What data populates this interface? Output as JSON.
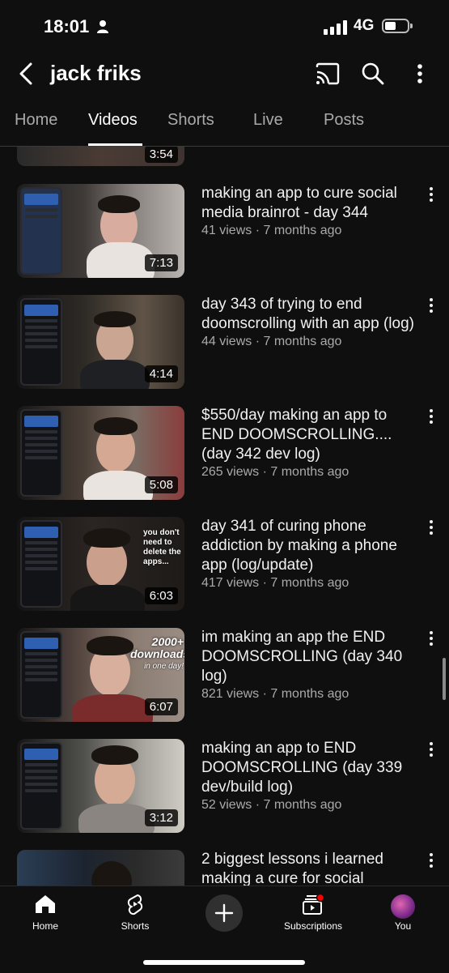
{
  "status": {
    "time": "18:01",
    "network": "4G"
  },
  "header": {
    "channel_name": "jack friks"
  },
  "tabs": [
    {
      "label": "Home"
    },
    {
      "label": "Videos",
      "active": true
    },
    {
      "label": "Shorts"
    },
    {
      "label": "Live"
    },
    {
      "label": "Posts"
    }
  ],
  "previous_video": {
    "duration": "3:54"
  },
  "videos": [
    {
      "title": "making an app to cure social media brainrot - day 344",
      "meta": "41 views · 7 months ago",
      "duration": "7:13"
    },
    {
      "title": "day 343 of trying to end doomscrolling with an app (log)",
      "meta": "44 views · 7 months ago",
      "duration": "4:14"
    },
    {
      "title": "$550/day making an app to END DOOMSCROLLING.... (day 342 dev log)",
      "meta": "265 views · 7 months ago",
      "duration": "5:08"
    },
    {
      "title": "day 341 of curing phone addiction by making a phone app (log/update)",
      "meta": "417 views · 7 months ago",
      "duration": "6:03",
      "overlay": "you don't need to delete the apps..."
    },
    {
      "title": "im making an app the END DOOMSCROLLING (day 340 log)",
      "meta": "821 views · 7 months ago",
      "duration": "6:07",
      "overlay_big": "2000+ downloads",
      "overlay_sub": "in one day!"
    },
    {
      "title": "making an app to END DOOMSCROLLING (day 339 dev/build log)",
      "meta": "52 views · 7 months ago",
      "duration": "3:12"
    },
    {
      "title": "2 biggest lessons i learned making a cure for social",
      "meta": "",
      "duration": ""
    }
  ],
  "bottom_nav": {
    "home": "Home",
    "shorts": "Shorts",
    "subscriptions": "Subscriptions",
    "you": "You"
  },
  "colors": {
    "background": "#0f0f0f",
    "text": "#f1f1f1",
    "secondary_text": "#aaaaaa",
    "notification_dot": "#ff0000"
  },
  "icons": [
    "person-icon",
    "signal-icon",
    "battery-icon",
    "back-icon",
    "cast-icon",
    "search-icon",
    "more-vert-icon",
    "home-icon",
    "shorts-icon",
    "plus-icon",
    "subscriptions-icon"
  ]
}
